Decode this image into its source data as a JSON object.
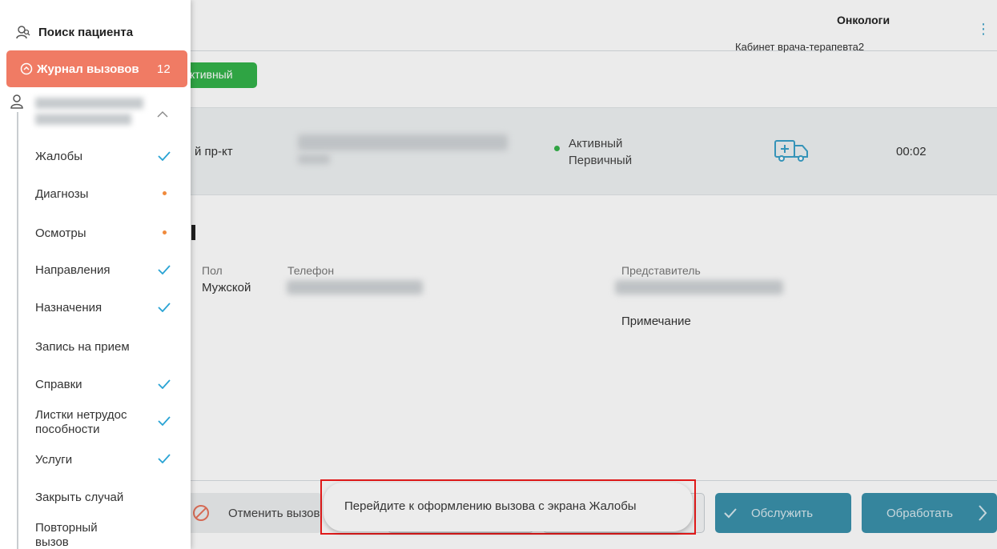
{
  "header": {
    "department": "Онкологи",
    "cabinet": "Кабинет врача-терапевта2"
  },
  "call": {
    "status_badge": "ктивный",
    "address_tail": "й пр-кт",
    "status_line1": "Активный",
    "status_line2": "Первичный",
    "timer": "00:02"
  },
  "patient": {
    "sex_label": "Пол",
    "sex_value": "Мужской",
    "phone_label": "Телефон",
    "representative_label": "Представитель",
    "note_label": "Примечание"
  },
  "footer": {
    "cancel_label": "Отменить вызов",
    "serve_label": "Обслужить",
    "process_label": "Обработать"
  },
  "sidebar": {
    "search_label": "Поиск пациента",
    "journal_label": "Журнал вызовов",
    "journal_count": "12",
    "items": [
      {
        "label": "Жалобы",
        "state": "done"
      },
      {
        "label": "Диагнозы",
        "state": "pending"
      },
      {
        "label": "Осмотры",
        "state": "pending"
      },
      {
        "label": "Направления",
        "state": "done"
      },
      {
        "label": "Назначения",
        "state": "done"
      },
      {
        "label": "Запись на прием",
        "state": "none"
      },
      {
        "label": "Справки",
        "state": "done"
      },
      {
        "label": "Листки нетрудос пособности",
        "state": "done"
      },
      {
        "label": "Услуги",
        "state": "done"
      },
      {
        "label": "Закрыть случай",
        "state": "none"
      },
      {
        "label": "Повторный вызов",
        "state": "none"
      }
    ]
  },
  "toast": {
    "message": "Перейдите к оформлению вызова с экрана Жалобы"
  },
  "colors": {
    "accent_teal": "#3a91ab",
    "journal_active": "#f07b64",
    "status_green": "#33b24a",
    "check_blue": "#29a3d4",
    "pending_orange": "#f08a3c",
    "highlight_red": "#e01919"
  }
}
